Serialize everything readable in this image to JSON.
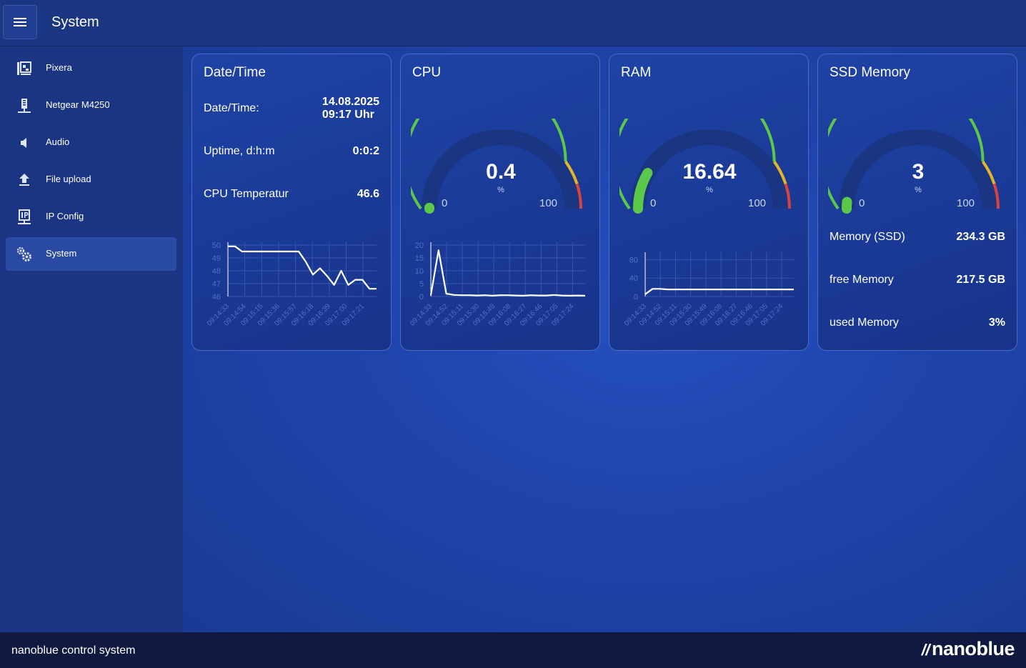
{
  "app": {
    "title": "System"
  },
  "sidebar": {
    "items": [
      {
        "label": "Pixera",
        "icon": "media-server-icon"
      },
      {
        "label": "Netgear M4250",
        "icon": "network-switch-icon"
      },
      {
        "label": "Audio",
        "icon": "speaker-icon"
      },
      {
        "label": "File upload",
        "icon": "upload-icon"
      },
      {
        "label": "IP Config",
        "icon": "ip-icon"
      },
      {
        "label": "System",
        "icon": "gears-icon",
        "active": true
      }
    ]
  },
  "datetime_card": {
    "title": "Date/Time",
    "rows": [
      {
        "label": "Date/Time:",
        "value_line1": "14.08.2025",
        "value_line2": "09:17 Uhr"
      },
      {
        "label": "Uptime, d:h:m",
        "value": "0:0:2"
      },
      {
        "label": "CPU Temperatur",
        "value": "46.6"
      }
    ]
  },
  "cpu_card": {
    "title": "CPU",
    "value": "0.4",
    "unit": "%",
    "min": "0",
    "max": "100"
  },
  "ram_card": {
    "title": "RAM",
    "value": "16.64",
    "unit": "%",
    "min": "0",
    "max": "100"
  },
  "ssd_card": {
    "title": "SSD Memory",
    "value": "3",
    "unit": "%",
    "min": "0",
    "max": "100",
    "rows": [
      {
        "label": "Memory (SSD)",
        "value": "234.3 GB"
      },
      {
        "label": "free Memory",
        "value": "217.5 GB"
      },
      {
        "label": "used Memory",
        "value": "3%"
      }
    ]
  },
  "colors": {
    "green": "#5cc84a",
    "yellow": "#e3b62a",
    "red": "#d8433c",
    "track": "#1a3582"
  },
  "chart_data": [
    {
      "type": "line",
      "title": "CPU Temperatur",
      "x": [
        "09:14:33",
        "09:14:54",
        "09:15:15",
        "09:15:36",
        "09:15:57",
        "09:16:18",
        "09:16:39",
        "09:17:00",
        "09:17:21"
      ],
      "y_ticks": [
        "46",
        "47",
        "48",
        "49",
        "50"
      ],
      "ylim": [
        46,
        50
      ],
      "values": [
        49.9,
        49.9,
        49.5,
        49.5,
        49.5,
        49.5,
        49.5,
        49.5,
        49.5,
        49.5,
        49.5,
        48.7,
        47.7,
        48.2,
        47.6,
        46.9,
        48.0,
        46.9,
        47.3,
        47.3,
        46.6,
        46.6
      ]
    },
    {
      "type": "line",
      "title": "CPU",
      "x": [
        "09:14:33",
        "09:14:52",
        "09:15:11",
        "09:15:30",
        "09:15:49",
        "09:16:08",
        "09:16:27",
        "09:16:46",
        "09:17:05",
        "09:17:24"
      ],
      "y_ticks": [
        "0",
        "5",
        "10",
        "15",
        "20"
      ],
      "ylim": [
        0,
        20
      ],
      "values": [
        0.5,
        18,
        1.1,
        0.6,
        0.5,
        0.5,
        0.4,
        0.5,
        0.3,
        0.5,
        0.5,
        0.4,
        0.3,
        0.5,
        0.4,
        0.4,
        0.6,
        0.4,
        0.3,
        0.4,
        0.3
      ]
    },
    {
      "type": "line",
      "title": "RAM",
      "x": [
        "09:14:33",
        "09:14:52",
        "09:15:11",
        "09:15:30",
        "09:15:49",
        "09:16:08",
        "09:16:27",
        "09:16:46",
        "09:17:05",
        "09:17:24"
      ],
      "y_ticks": [
        "0",
        "40",
        "80"
      ],
      "ylim": [
        0,
        90
      ],
      "values": [
        5,
        16.6,
        16.6,
        15.3,
        15.3,
        15.3,
        15.3,
        15.3,
        15.3,
        15.3,
        15.3,
        15.3,
        15.3,
        15.3,
        15.3,
        15.3,
        15.3,
        15.3,
        15.3,
        15.3,
        15.3
      ]
    }
  ],
  "footer": {
    "text": "nanoblue control system",
    "brand_slashes": "//",
    "brand_name": "nanoblue"
  }
}
